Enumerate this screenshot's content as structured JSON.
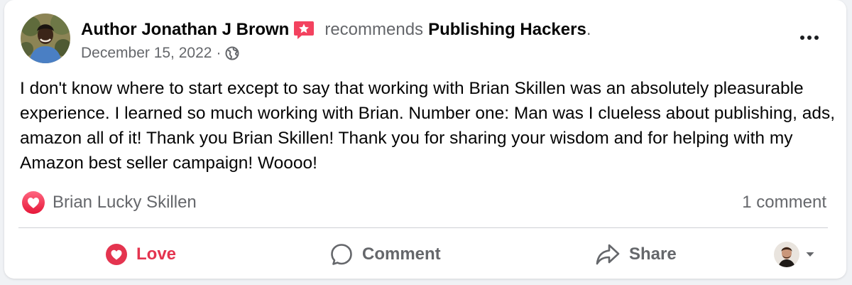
{
  "post": {
    "author_name": "Author Jonathan J Brown",
    "verb": "recommends",
    "page_name": "Publishing Hackers",
    "trailing_period": ".",
    "date": "December 15, 2022",
    "separator": "·",
    "audience_icon": "globe-icon",
    "more_icon": "more-options-icon",
    "body": "I don't know where to start except to say that working with Brian Skillen was an absolutely pleasurable experience. I learned so much working with Brian. Number one: Man was I clueless about publishing, ads, amazon all of it! Thank you Brian Skillen! Thank you for sharing your wisdom and for helping with my Amazon best seller campaign! Woooo!"
  },
  "reactions": {
    "icon": "love-reaction-icon",
    "names": "Brian Lucky Skillen",
    "comments_count": "1 comment"
  },
  "actions": {
    "love_label": "Love",
    "comment_label": "Comment",
    "share_label": "Share"
  },
  "colors": {
    "love": "#e4344f",
    "secondary_text": "#65676b",
    "recommend_badge": "#f3425f"
  }
}
